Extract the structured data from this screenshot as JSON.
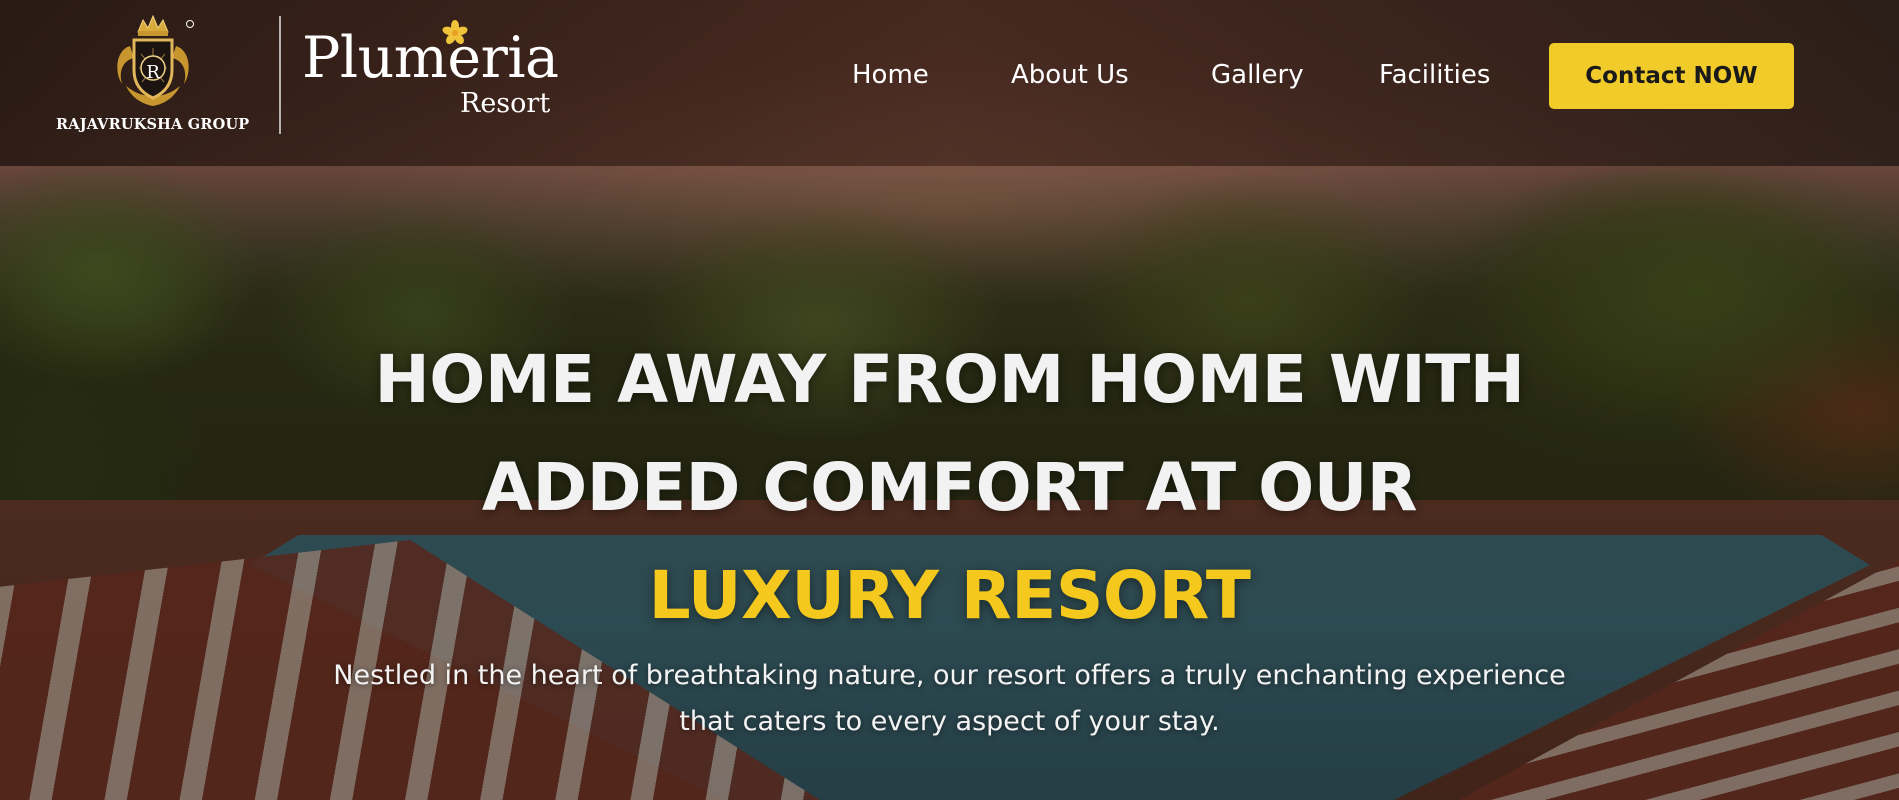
{
  "brand": {
    "group_name": "RAJAVRUKSHA GROUP",
    "crest_letter": "R",
    "resort_name": "Plumeria",
    "resort_sub": "Resort"
  },
  "nav": {
    "items": [
      {
        "label": "Home"
      },
      {
        "label": "About Us"
      },
      {
        "label": "Gallery"
      },
      {
        "label": "Facilities"
      }
    ],
    "cta_label": "Contact NOW"
  },
  "hero": {
    "headline_line1": "HOME AWAY FROM HOME WITH",
    "headline_line2": "ADDED COMFORT AT OUR",
    "headline_accent": "LUXURY RESORT",
    "subtext_line1": "Nestled in the heart of breathtaking nature, our resort offers a truly enchanting experience",
    "subtext_line2": "that caters to every aspect of your stay."
  },
  "colors": {
    "accent": "#f1cb2a",
    "headline_accent": "#f4c81c",
    "text_light": "#f2f2f2"
  }
}
